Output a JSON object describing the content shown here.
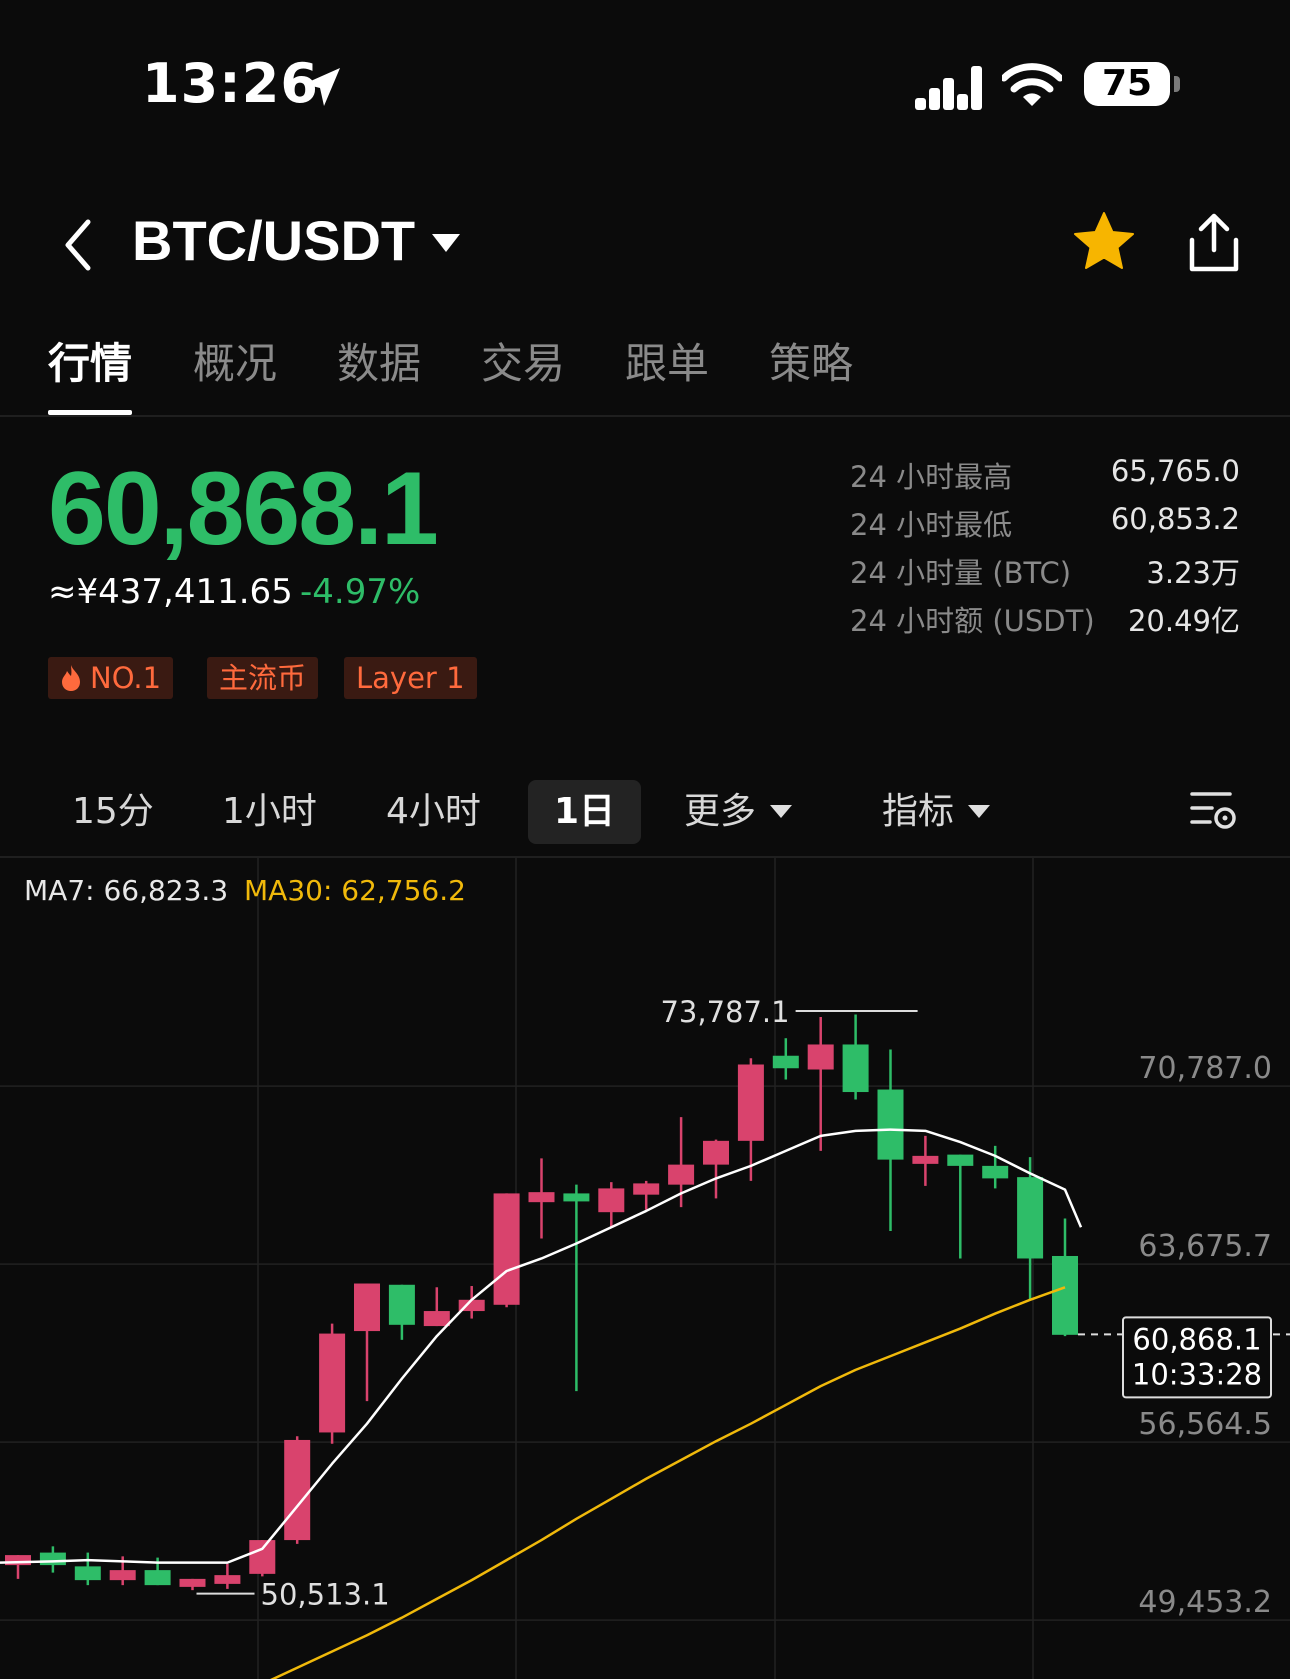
{
  "status_bar": {
    "time": "13:26",
    "battery": "75"
  },
  "header": {
    "pair": "BTC/USDT"
  },
  "tabs": [
    {
      "label": "行情",
      "active": true
    },
    {
      "label": "概况",
      "active": false
    },
    {
      "label": "数据",
      "active": false
    },
    {
      "label": "交易",
      "active": false
    },
    {
      "label": "跟单",
      "active": false
    },
    {
      "label": "策略",
      "active": false
    }
  ],
  "ticker": {
    "last_price": "60,868.1",
    "cny_price": "≈¥437,411.65",
    "change_pct": "-4.97%",
    "tags": [
      "NO.1",
      "主流币",
      "Layer 1"
    ]
  },
  "stats": [
    {
      "label": "24 小时最高",
      "value": "65,765.0"
    },
    {
      "label": "24 小时最低",
      "value": "60,853.2"
    },
    {
      "label": "24 小时量 (BTC)",
      "value": "3.23万"
    },
    {
      "label": "24 小时额 (USDT)",
      "value": "20.49亿"
    }
  ],
  "intervals": {
    "m15": "15分",
    "h1": "1小时",
    "h4": "4小时",
    "d1": "1日",
    "more": "更多",
    "indicators": "指标",
    "selected": "1日"
  },
  "colors": {
    "up": "#d9436d",
    "down": "#2ebd68",
    "ma7": "#ffffff",
    "ma30": "#f0b90b"
  },
  "chart_data": {
    "type": "candlestick",
    "ma7_label": "MA7: 66,823.3",
    "ma30_label": "MA30: 62,756.2",
    "y_ticks": [
      "70,787.0",
      "63,675.7",
      "56,564.5",
      "49,453.2"
    ],
    "y_tick_values": [
      70787.0,
      63675.7,
      56564.5,
      49453.2
    ],
    "ylim": [
      47100,
      79900
    ],
    "max_marker": {
      "label": "73,787.1",
      "value": 73787.1
    },
    "min_marker": {
      "label": "50,513.1",
      "value": 50513.1
    },
    "current": {
      "price_label": "60,868.1",
      "time_label": "10:33:28",
      "value": 60868.1
    },
    "candles": [
      {
        "o": 51650,
        "h": 51950,
        "l": 51100,
        "c": 52050
      },
      {
        "o": 52150,
        "h": 52400,
        "l": 51350,
        "c": 51650
      },
      {
        "o": 51600,
        "h": 52150,
        "l": 50850,
        "c": 51050
      },
      {
        "o": 51050,
        "h": 52000,
        "l": 50850,
        "c": 51450
      },
      {
        "o": 51450,
        "h": 51950,
        "l": 50900,
        "c": 50850
      },
      {
        "o": 50900,
        "h": 51000,
        "l": 50650,
        "c": 51100
      },
      {
        "o": 50900,
        "h": 51700,
        "l": 50700,
        "c": 51250
      },
      {
        "o": 51300,
        "h": 52600,
        "l": 51200,
        "c": 52650
      },
      {
        "o": 52650,
        "h": 56800,
        "l": 52500,
        "c": 56650
      },
      {
        "o": 56950,
        "h": 61300,
        "l": 56500,
        "c": 60900
      },
      {
        "o": 61000,
        "h": 62650,
        "l": 58200,
        "c": 62900
      },
      {
        "o": 62850,
        "h": 62800,
        "l": 60650,
        "c": 61250
      },
      {
        "o": 61200,
        "h": 62750,
        "l": 61200,
        "c": 61800
      },
      {
        "o": 61800,
        "h": 62800,
        "l": 61500,
        "c": 62250
      },
      {
        "o": 62050,
        "h": 66500,
        "l": 61950,
        "c": 66500
      },
      {
        "o": 66150,
        "h": 67900,
        "l": 64700,
        "c": 66550
      },
      {
        "o": 66500,
        "h": 66850,
        "l": 58600,
        "c": 66200
      },
      {
        "o": 65750,
        "h": 66950,
        "l": 65150,
        "c": 66700
      },
      {
        "o": 66450,
        "h": 67000,
        "l": 65850,
        "c": 66900
      },
      {
        "o": 66850,
        "h": 69550,
        "l": 65950,
        "c": 67650
      },
      {
        "o": 67650,
        "h": 68650,
        "l": 66300,
        "c": 68600
      },
      {
        "o": 68600,
        "h": 71900,
        "l": 67000,
        "c": 71650
      },
      {
        "o": 72000,
        "h": 72700,
        "l": 71050,
        "c": 71500
      },
      {
        "o": 71450,
        "h": 73550,
        "l": 68200,
        "c": 72450
      },
      {
        "o": 72450,
        "h": 73650,
        "l": 70250,
        "c": 70550
      },
      {
        "o": 70650,
        "h": 72250,
        "l": 65000,
        "c": 67850
      },
      {
        "o": 67850,
        "h": 68800,
        "l": 66800,
        "c": 68000
      },
      {
        "o": 68050,
        "h": 68050,
        "l": 63900,
        "c": 67600
      },
      {
        "o": 67600,
        "h": 68400,
        "l": 66700,
        "c": 67100
      },
      {
        "o": 67150,
        "h": 67950,
        "l": 62250,
        "c": 63900
      },
      {
        "o": 64000,
        "h": 65500,
        "l": 60800,
        "c": 60850
      }
    ],
    "ma7": [
      51750,
      51800,
      51850,
      51800,
      51750,
      51750,
      51750,
      52300,
      54000,
      55700,
      57300,
      59100,
      60800,
      62250,
      63400,
      63900,
      64500,
      65150,
      65800,
      66500,
      67100,
      67600,
      68200,
      68800,
      69000,
      69050,
      69000,
      68550,
      68000,
      67300,
      66650
    ],
    "ma30": [
      null,
      null,
      null,
      null,
      null,
      null,
      null,
      46900,
      47550,
      48200,
      48850,
      49550,
      50300,
      51050,
      51850,
      52650,
      53500,
      54300,
      55100,
      55850,
      56600,
      57300,
      58050,
      58800,
      59450,
      60000,
      60550,
      61100,
      61700,
      62250,
      62750
    ]
  }
}
